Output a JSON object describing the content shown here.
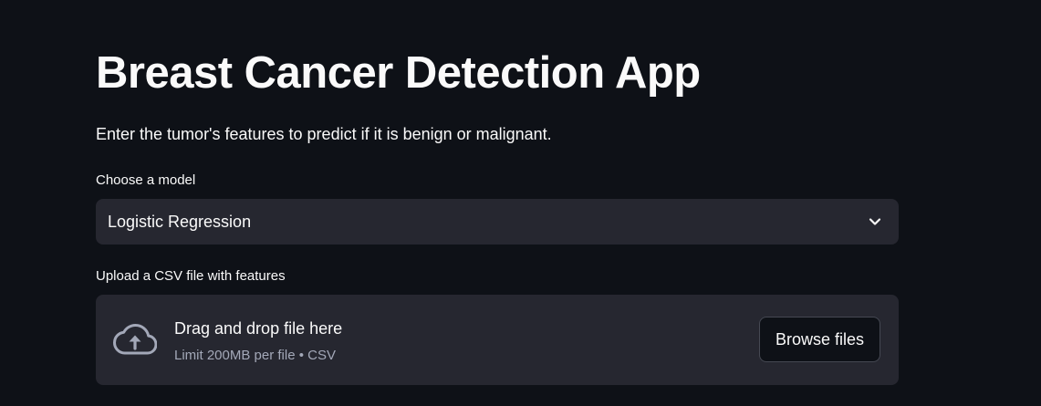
{
  "app": {
    "title": "Breast Cancer Detection App",
    "subtitle": "Enter the tumor's features to predict if it is benign or malignant."
  },
  "model_select": {
    "label": "Choose a model",
    "value": "Logistic Regression",
    "icon": "chevron-down-icon"
  },
  "uploader": {
    "label": "Upload a CSV file with features",
    "drop_title": "Drag and drop file here",
    "limit_text": "Limit 200MB per file • CSV",
    "browse_label": "Browse files",
    "icon": "cloud-upload-icon"
  },
  "colors": {
    "background": "#0e1117",
    "widget_background": "#262730",
    "text": "#fafafa",
    "muted_text": "#a3a8b8"
  }
}
